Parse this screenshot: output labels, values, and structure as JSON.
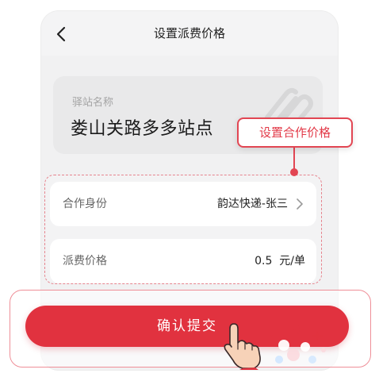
{
  "header": {
    "title": "设置派费价格",
    "back_icon": "chevron-left-icon"
  },
  "station": {
    "label": "驿站名称",
    "name": "娄山关路多多站点",
    "decor_icon": "paperclip-icon"
  },
  "annotation": {
    "text": "设置合作价格"
  },
  "form": {
    "identity": {
      "label": "合作身份",
      "value": "韵达快递-张三",
      "icon": "chevron-right-icon"
    },
    "price": {
      "label": "派费价格",
      "value": "0.5  元/单"
    }
  },
  "submit": {
    "label": "确认提交",
    "pointer_icon": "tap-hand-icon"
  },
  "colors": {
    "accent": "#e1323f",
    "annotation": "#e24653",
    "background": "#f1f1f2"
  }
}
